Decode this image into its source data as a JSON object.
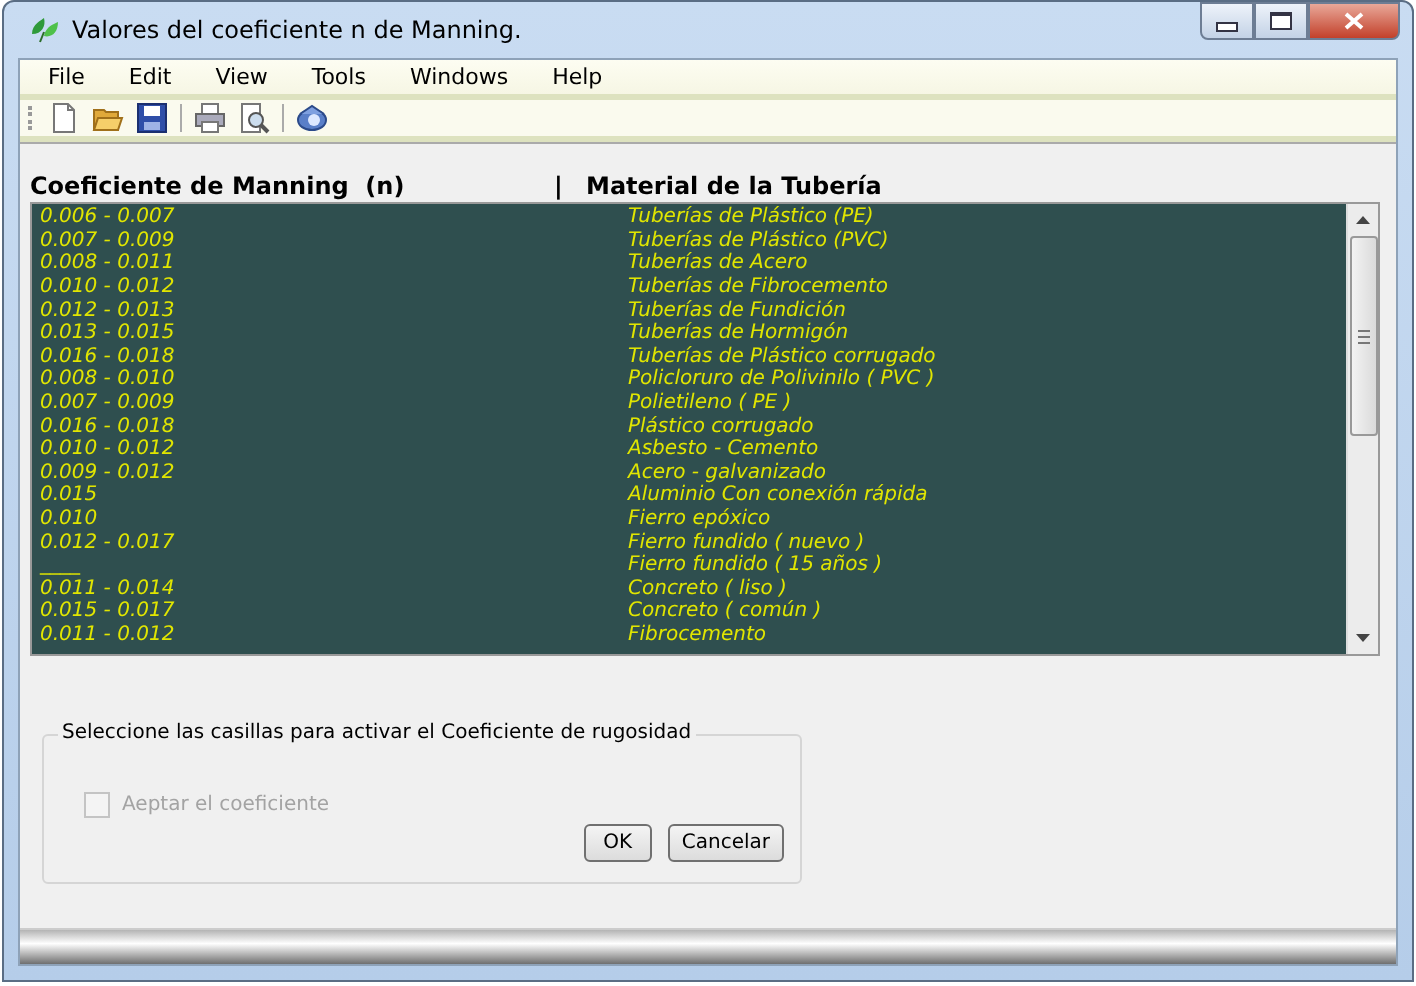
{
  "window": {
    "title": "Valores del coeficiente n de Manning."
  },
  "menu": [
    "File",
    "Edit",
    "View",
    "Tools",
    "Windows",
    "Help"
  ],
  "toolbar": [
    {
      "kind": "new"
    },
    {
      "kind": "open"
    },
    {
      "kind": "save"
    },
    {
      "kind": "separator"
    },
    {
      "kind": "print"
    },
    {
      "kind": "preview"
    },
    {
      "kind": "separator"
    },
    {
      "kind": "help"
    }
  ],
  "list_header": {
    "column_1": "Coeficiente de Manning  (n)",
    "divider": "|",
    "column_2": "Material de la Tubería"
  },
  "rows": [
    {
      "coefficient": "0.006 - 0.007",
      "material": "Tuberías de Plástico (PE)"
    },
    {
      "coefficient": "0.007 - 0.009",
      "material": "Tuberías de Plástico (PVC)"
    },
    {
      "coefficient": "0.008 - 0.011",
      "material": "Tuberías de Acero"
    },
    {
      "coefficient": "0.010 - 0.012",
      "material": "Tuberías de Fibrocemento"
    },
    {
      "coefficient": "0.012 - 0.013",
      "material": "Tuberías de Fundición"
    },
    {
      "coefficient": "0.013 - 0.015",
      "material": "Tuberías de Hormigón"
    },
    {
      "coefficient": "0.016 - 0.018",
      "material": "Tuberías de Plástico corrugado"
    },
    {
      "coefficient": "0.008 - 0.010",
      "material": "Policloruro de Polivinilo ( PVC )"
    },
    {
      "coefficient": "0.007 - 0.009",
      "material": "Polietileno ( PE )"
    },
    {
      "coefficient": "0.016 - 0.018",
      "material": "Plástico corrugado"
    },
    {
      "coefficient": "0.010 - 0.012",
      "material": "Asbesto - Cemento"
    },
    {
      "coefficient": "0.009 - 0.012",
      "material": "Acero - galvanizado"
    },
    {
      "coefficient": "0.015",
      "material": "Aluminio Con conexión rápida"
    },
    {
      "coefficient": "0.010",
      "material": "Fierro epóxico"
    },
    {
      "coefficient": "0.012 - 0.017",
      "material": "Fierro fundido ( nuevo )"
    },
    {
      "coefficient": "____",
      "material": "Fierro fundido ( 15 años )"
    },
    {
      "coefficient": "0.011 - 0.014",
      "material": "Concreto ( liso )"
    },
    {
      "coefficient": "0.015 - 0.017",
      "material": "Concreto  ( común )"
    },
    {
      "coefficient": "0.011 - 0.012",
      "material": "Fibrocemento"
    }
  ],
  "group": {
    "legend": "Seleccione  las casillas para activar el  Coeficiente de rugosidad",
    "checkbox": {
      "label": "Aeptar el coeficiente",
      "checked": false,
      "disabled": true
    },
    "buttons": [
      "OK",
      "Cancelar"
    ]
  }
}
